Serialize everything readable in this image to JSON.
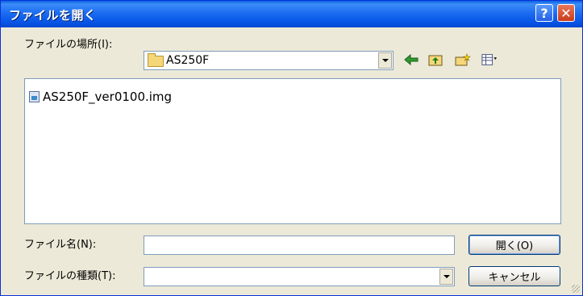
{
  "window": {
    "title": "ファイルを開く",
    "help_label": "?",
    "close_label": "✕"
  },
  "location": {
    "label": "ファイルの場所(I):",
    "value": "AS250F"
  },
  "toolbar": {
    "icons": [
      "back-icon",
      "up-folder-icon",
      "new-folder-icon",
      "view-menu-icon"
    ]
  },
  "files": [
    {
      "name": "AS250F_ver0100.img",
      "icon": "image-file-icon"
    }
  ],
  "filename": {
    "label": "ファイル名(N):",
    "value": ""
  },
  "filetype": {
    "label": "ファイルの種類(T):",
    "value": ""
  },
  "buttons": {
    "open_label": "開く(O)",
    "cancel_label": "キャンセル"
  },
  "colors": {
    "titlebar": "#0755E6",
    "dialog_bg": "#ECE9D8",
    "close_button": "#C83B1A"
  }
}
